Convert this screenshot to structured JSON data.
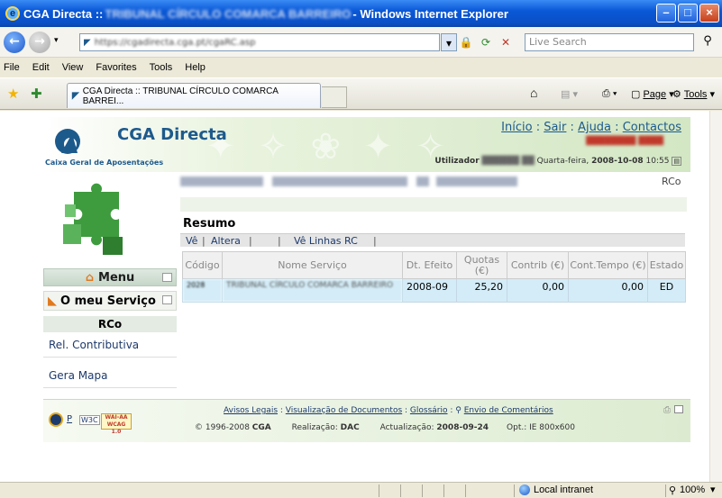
{
  "browser": {
    "title_prefix": "CGA Directa :: ",
    "title_blurred": "TRIBUNAL CÍRCULO COMARCA BARREIRO",
    "title_suffix": " - Windows Internet Explorer",
    "address": "https://cgadirecta.cga.pt/cgaRC.asp",
    "search_placeholder": "Live Search",
    "menu": [
      "File",
      "Edit",
      "View",
      "Favorites",
      "Tools",
      "Help"
    ],
    "tab_label": "CGA Directa :: TRIBUNAL CÍRCULO COMARCA BARREI...",
    "cmd_page": "Page",
    "cmd_tools": "Tools",
    "status_zone": "Local intranet",
    "status_zoom": "100%"
  },
  "header": {
    "brand": "CGA Directa",
    "brand_sub": "Caixa Geral de Aposentações",
    "links": [
      "Início",
      "Sair",
      "Ajuda",
      "Contactos"
    ],
    "user_label": "Utilizador",
    "date_text": "Quarta-feira, ",
    "date": "2008-10-08",
    "time": " 10:55",
    "rco": "RCo"
  },
  "sidebar": {
    "menu_label": "Menu",
    "service_label": "O meu Serviço",
    "section": "RCo",
    "links": [
      "Rel. Contributiva",
      "Gera Mapa"
    ]
  },
  "main": {
    "section_title": "Resumo",
    "actions": [
      "Vê",
      "Altera",
      "Vê Linhas RC"
    ],
    "columns": [
      "Código",
      "Nome Serviço",
      "Dt. Efeito",
      "Quotas (€)",
      "Contrib (€)",
      "Cont.Tempo (€)",
      "Estado"
    ],
    "rows": [
      {
        "codigo": "2028",
        "nome": "TRIBUNAL CÍRCULO COMARCA BARREIRO",
        "dt_efeito": "2008-09",
        "quotas": "25,20",
        "contrib": "0,00",
        "cont_tempo": "0,00",
        "estado": "ED"
      }
    ]
  },
  "footer": {
    "links": [
      "Avisos Legais",
      "Visualização de Documentos",
      "Glossário",
      "Envio de Comentários"
    ],
    "copyright": "© 1996-2008 ",
    "copyright_bold": "CGA",
    "realizacao_label": "Realização: ",
    "realizacao": "DAC",
    "actualizacao_label": "Actualização: ",
    "actualizacao": "2008-09-24",
    "opt": "Opt.: IE 800x600",
    "wai_badge": "WAI-AA WCAG 1.0"
  },
  "colors": {
    "brand_blue": "#1d5a8c",
    "row_blue": "#d4ecf7",
    "header_green": "#d3e7c4"
  }
}
